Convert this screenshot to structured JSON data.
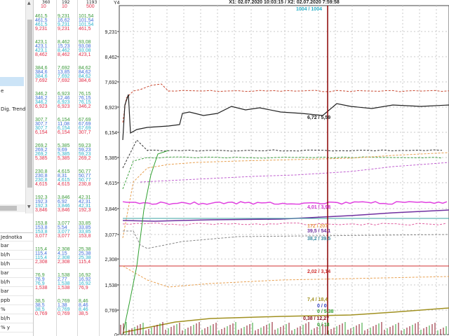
{
  "left_panel": {
    "list_text_1": "e",
    "list_text_2": "Dig. Trendy",
    "table_header": "Jednotka",
    "units": [
      "bar",
      "bl/h",
      "bl/h",
      "bar",
      "bl/h",
      "bar",
      "ppb",
      "%",
      "bl/h",
      "% y"
    ]
  },
  "columns": {
    "headers": [
      "360",
      "192",
      "1193"
    ],
    "top_values": [
      {
        "c1": "10",
        "c2": "10",
        "c3": "500"
      }
    ]
  },
  "value_groups": [
    {
      "y": 20,
      "rows": [
        [
          "461,5",
          "9,231",
          "101,54"
        ],
        [
          "461,5",
          "16,62",
          "101,54"
        ],
        [
          "461,5",
          "9,231",
          "101,54"
        ],
        [
          "9,231",
          "9,231",
          "461,5"
        ]
      ]
    },
    {
      "y": 57,
      "rows": [
        [
          "423,1",
          "8,462",
          "93,08"
        ],
        [
          "423,1",
          "15,23",
          "93,08"
        ],
        [
          "423,1",
          "8,462",
          "93,08"
        ],
        [
          "8,462",
          "8,462",
          "423,1"
        ]
      ]
    },
    {
      "y": 94,
      "rows": [
        [
          "384,6",
          "7,692",
          "84,62"
        ],
        [
          "384,6",
          "13,85",
          "84,62"
        ],
        [
          "384,6",
          "7,692",
          "84,62"
        ],
        [
          "7,692",
          "7,692",
          "384,6"
        ]
      ]
    },
    {
      "y": 131,
      "rows": [
        [
          "346,2",
          "6,923",
          "76,15"
        ],
        [
          "346,2",
          "12,46",
          "76,15"
        ],
        [
          "346,2",
          "6,923",
          "76,15"
        ],
        [
          "6,923",
          "6,923",
          "346,2"
        ]
      ]
    },
    {
      "y": 168,
      "rows": [
        [
          "307,7",
          "6,154",
          "67,69"
        ],
        [
          "307,7",
          "11,08",
          "67,69"
        ],
        [
          "307,7",
          "6,154",
          "67,69"
        ],
        [
          "6,154",
          "6,154",
          "307,7"
        ]
      ]
    },
    {
      "y": 205,
      "rows": [
        [
          "269,2",
          "5,385",
          "59,23"
        ],
        [
          "269,2",
          "9,69",
          "59,23"
        ],
        [
          "269,2",
          "5,385",
          "59,23"
        ],
        [
          "5,385",
          "5,385",
          "269,2"
        ]
      ]
    },
    {
      "y": 242,
      "rows": [
        [
          "230,8",
          "4,615",
          "50,77"
        ],
        [
          "230,8",
          "8,31",
          "50,77"
        ],
        [
          "230,8",
          "4,615",
          "50,77"
        ],
        [
          "4,615",
          "4,615",
          "230,8"
        ]
      ]
    },
    {
      "y": 279,
      "rows": [
        [
          "192,3",
          "3,846",
          "42,31"
        ],
        [
          "192,3",
          "6,92",
          "42,31"
        ],
        [
          "192,3",
          "3,846",
          "42,31"
        ],
        [
          "3,846",
          "3,846",
          "192,3"
        ]
      ]
    },
    {
      "y": 316,
      "rows": [
        [
          "153,8",
          "3,077",
          "33,85"
        ],
        [
          "153,8",
          "5,54",
          "33,85"
        ],
        [
          "153,8",
          "3,077",
          "33,85"
        ],
        [
          "3,077",
          "3,077",
          "153,8"
        ]
      ]
    },
    {
      "y": 353,
      "rows": [
        [
          "115,4",
          "2,308",
          "25,38"
        ],
        [
          "115,4",
          "4,15",
          "25,38"
        ],
        [
          "115,4",
          "2,308",
          "25,38"
        ],
        [
          "2,308",
          "2,308",
          "115,4"
        ]
      ]
    },
    {
      "y": 390,
      "rows": [
        [
          "76,9",
          "1,538",
          "16,92"
        ],
        [
          "76,9",
          "2,77",
          "16,92"
        ],
        [
          "76,9",
          "1,538",
          "16,92"
        ],
        [
          "1,538",
          "1,538",
          "76,9"
        ]
      ]
    },
    {
      "y": 427,
      "rows": [
        [
          "38,5",
          "0,769",
          "8,46"
        ],
        [
          "38,5",
          "1,38",
          "8,46"
        ],
        [
          "38,5",
          "0,769",
          "8,46"
        ],
        [
          "0,769",
          "0,769",
          "38,5"
        ]
      ]
    }
  ],
  "row_colors": [
    "#3a9a3a",
    "#3c6cd8",
    "#2ab0c8",
    "#e0304a"
  ],
  "chart": {
    "header": "X1: 02.07.2020 10:03:15 / X2: 02.07.2020 7:59:58",
    "y_axis_label": "Y4",
    "y_ticks": [
      "9,231",
      "8,462",
      "7,692",
      "6,923",
      "6,154",
      "5,385",
      "4,615",
      "3,846",
      "3,077",
      "2,308",
      "1,538",
      "0,769",
      "0"
    ],
    "annotations": [
      {
        "text": "1004 / 1004",
        "color": "#2ab0c8"
      },
      {
        "text": "6,72 / 5,59",
        "color": "#222222"
      },
      {
        "text": "4,01 / 3,98",
        "color": "#d030d0"
      },
      {
        "text": "172 / 207",
        "color": "#e8a050"
      },
      {
        "text": "39,5 / 54,1",
        "color": "#7030a0"
      },
      {
        "text": "38,2 / 39,5",
        "color": "#3a8aa0"
      },
      {
        "text": "2,02 / 3,14",
        "color": "#d03030"
      },
      {
        "text": "7,4 / 18,4",
        "color": "#a09020"
      },
      {
        "text": "0 / 0",
        "color": "#3040c0"
      },
      {
        "text": "0 / 5,38",
        "color": "#30a030"
      },
      {
        "text": "0,38 / 12,27",
        "color": "#8a1020"
      },
      {
        "text": "0 / 18",
        "color": "#30a030"
      }
    ]
  }
}
